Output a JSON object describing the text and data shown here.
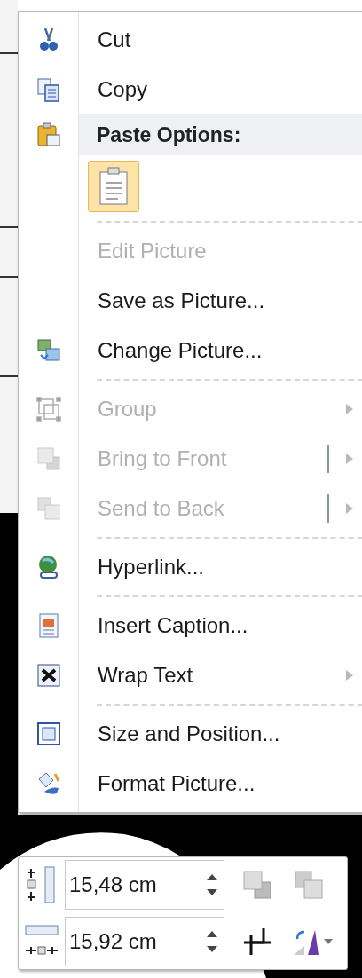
{
  "context_menu": {
    "items": [
      {
        "kind": "item",
        "label": "Cut",
        "disabled": false,
        "submenu": false,
        "split": false
      },
      {
        "kind": "item",
        "label": "Copy",
        "disabled": false,
        "submenu": false,
        "split": false
      },
      {
        "kind": "header",
        "label": "Paste Options:"
      },
      {
        "kind": "paste_options"
      },
      {
        "kind": "separator"
      },
      {
        "kind": "item",
        "label": "Edit Picture",
        "disabled": true,
        "submenu": false,
        "split": false
      },
      {
        "kind": "item",
        "label": "Save as Picture...",
        "disabled": false,
        "submenu": false,
        "split": false
      },
      {
        "kind": "item",
        "label": "Change Picture...",
        "disabled": false,
        "submenu": false,
        "split": false
      },
      {
        "kind": "separator"
      },
      {
        "kind": "item",
        "label": "Group",
        "disabled": true,
        "submenu": true,
        "split": false
      },
      {
        "kind": "item",
        "label": "Bring to Front",
        "disabled": true,
        "submenu": true,
        "split": true
      },
      {
        "kind": "item",
        "label": "Send to Back",
        "disabled": true,
        "submenu": true,
        "split": true
      },
      {
        "kind": "separator"
      },
      {
        "kind": "item",
        "label": "Hyperlink...",
        "disabled": false,
        "submenu": false,
        "split": false
      },
      {
        "kind": "separator"
      },
      {
        "kind": "item",
        "label": "Insert Caption...",
        "disabled": false,
        "submenu": false,
        "split": false
      },
      {
        "kind": "item",
        "label": "Wrap Text",
        "disabled": false,
        "submenu": true,
        "split": false
      },
      {
        "kind": "separator"
      },
      {
        "kind": "item",
        "label": "Size and Position...",
        "disabled": false,
        "submenu": false,
        "split": false
      },
      {
        "kind": "item",
        "label": "Format Picture...",
        "disabled": false,
        "submenu": false,
        "split": false
      }
    ]
  },
  "mini_toolbar": {
    "height_field": {
      "value": "15,48 cm"
    },
    "width_field": {
      "value": "15,92 cm"
    }
  }
}
